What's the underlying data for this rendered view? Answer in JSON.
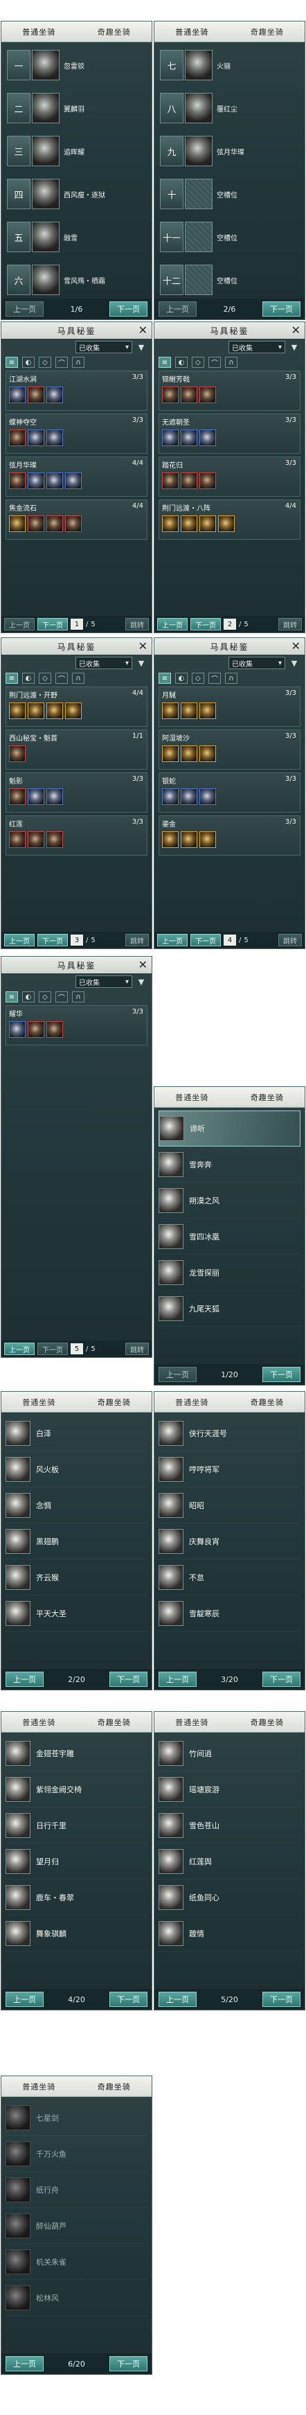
{
  "common": {
    "tab_normal": "普通坐骑",
    "tab_special": "奇趣坐骑",
    "prev": "上一页",
    "next": "下一页",
    "tack_title": "马具秘鉴",
    "collected": "已收集",
    "jump": "跳转",
    "close": "✕"
  },
  "mount_slots": {
    "page": "1/6",
    "left": [
      {
        "num": "一",
        "label": "忽雷驳"
      },
      {
        "num": "二",
        "label": "翼麟羽"
      },
      {
        "num": "三",
        "label": "追晖耀"
      },
      {
        "num": "四",
        "label": "西风瘦・逐狱"
      },
      {
        "num": "五",
        "label": "融雪"
      },
      {
        "num": "六",
        "label": "雪风殇・栖霜"
      }
    ]
  },
  "mount_slots_2": {
    "page": "2/6",
    "right": [
      {
        "num": "七",
        "label": "火骊"
      },
      {
        "num": "八",
        "label": "覆红尘"
      },
      {
        "num": "九",
        "label": "弦月华璨"
      },
      {
        "num": "十",
        "label": "空槽位"
      },
      {
        "num": "十一",
        "label": "空槽位"
      },
      {
        "num": "十二",
        "label": "空槽位"
      }
    ]
  },
  "tack_pages": [
    {
      "page": "1",
      "total": "5",
      "sets": [
        {
          "name": "江湖水涧",
          "count": "3/3",
          "items": [
            "b",
            "r",
            "b"
          ]
        },
        {
          "name": "蝶神夺空",
          "count": "3/3",
          "items": [
            "r",
            "b",
            "b"
          ]
        },
        {
          "name": "弦月华璨",
          "count": "4/4",
          "items": [
            "r",
            "b",
            "b",
            "b"
          ]
        },
        {
          "name": "焦金流石",
          "count": "4/4",
          "items": [
            "g",
            "r",
            "r",
            "r"
          ]
        }
      ]
    },
    {
      "page": "2",
      "total": "5",
      "sets": [
        {
          "name": "锦榭芳戟",
          "count": "3/3",
          "items": [
            "r",
            "r",
            "r"
          ]
        },
        {
          "name": "无遮朝圣",
          "count": "3/3",
          "items": [
            "b",
            "b",
            "b"
          ]
        },
        {
          "name": "踏花归",
          "count": "3/3",
          "items": [
            "r",
            "r",
            "r"
          ]
        },
        {
          "name": "荆门远渡・八阵",
          "count": "4/4",
          "items": [
            "g",
            "g",
            "g",
            "g"
          ]
        }
      ]
    },
    {
      "page": "3",
      "total": "5",
      "sets": [
        {
          "name": "荆门远渡・开野",
          "count": "4/4",
          "items": [
            "g",
            "g",
            "g",
            "g"
          ]
        },
        {
          "name": "西山秘宝・魁首",
          "count": "1/1",
          "items": [
            "r"
          ]
        },
        {
          "name": "魁影",
          "count": "3/3",
          "items": [
            "r",
            "b",
            "b"
          ]
        },
        {
          "name": "红莲",
          "count": "3/3",
          "items": [
            "r",
            "r",
            "r"
          ]
        }
      ]
    },
    {
      "page": "4",
      "total": "5",
      "sets": [
        {
          "name": "月駴",
          "count": "3/3",
          "items": [
            "g",
            "g",
            "g"
          ]
        },
        {
          "name": "阿湿坡沙",
          "count": "3/3",
          "items": [
            "g",
            "g",
            "g"
          ]
        },
        {
          "name": "银蛇",
          "count": "3/3",
          "items": [
            "b",
            "b",
            "b"
          ]
        },
        {
          "name": "鎏金",
          "count": "3/3",
          "items": [
            "g",
            "g",
            "g"
          ]
        }
      ]
    },
    {
      "page": "5",
      "total": "5",
      "sets": [
        {
          "name": "耀华",
          "count": "3/3",
          "items": [
            "b",
            "r",
            "r"
          ]
        }
      ]
    }
  ],
  "special_pages": [
    {
      "page": "1/20",
      "rows": [
        {
          "name": "谛听",
          "on": true
        },
        {
          "name": "雪奔奔"
        },
        {
          "name": "朔漠之风"
        },
        {
          "name": "雪四冰凰"
        },
        {
          "name": "龙雪探丽"
        },
        {
          "name": "九尾天狐"
        }
      ]
    },
    {
      "page": "2/20",
      "rows": [
        {
          "name": "白泽"
        },
        {
          "name": "风火板"
        },
        {
          "name": "念惆"
        },
        {
          "name": "黑翅鹏"
        },
        {
          "name": "齐云猴"
        },
        {
          "name": "平天大圣"
        }
      ]
    },
    {
      "page": "3/20",
      "rows": [
        {
          "name": "侠行天涯号"
        },
        {
          "name": "哼哼将军"
        },
        {
          "name": "昭昭"
        },
        {
          "name": "庆舞良宵"
        },
        {
          "name": "不怠"
        },
        {
          "name": "雪靛寒辰"
        }
      ]
    },
    {
      "page": "4/20",
      "rows": [
        {
          "name": "金翅苍宇雕"
        },
        {
          "name": "紫翎金阙交椅"
        },
        {
          "name": "日行千里"
        },
        {
          "name": "望月归"
        },
        {
          "name": "鹿车・春翠"
        },
        {
          "name": "舞象骐麟"
        }
      ]
    },
    {
      "page": "5/20",
      "rows": [
        {
          "name": "竹间逍"
        },
        {
          "name": "瑶塘宸游"
        },
        {
          "name": "雪色苍山"
        },
        {
          "name": "红莲舆"
        },
        {
          "name": "纸鱼同心"
        },
        {
          "name": "踱情"
        }
      ]
    },
    {
      "page": "6/20",
      "rows": [
        {
          "name": "七星剑",
          "lock": true
        },
        {
          "name": "千万火鱼",
          "lock": true
        },
        {
          "name": "纸行舟",
          "lock": true
        },
        {
          "name": "醉仙葫芦",
          "lock": true
        },
        {
          "name": "机关朱雀",
          "lock": true
        },
        {
          "name": "松林风",
          "lock": true
        }
      ]
    }
  ]
}
